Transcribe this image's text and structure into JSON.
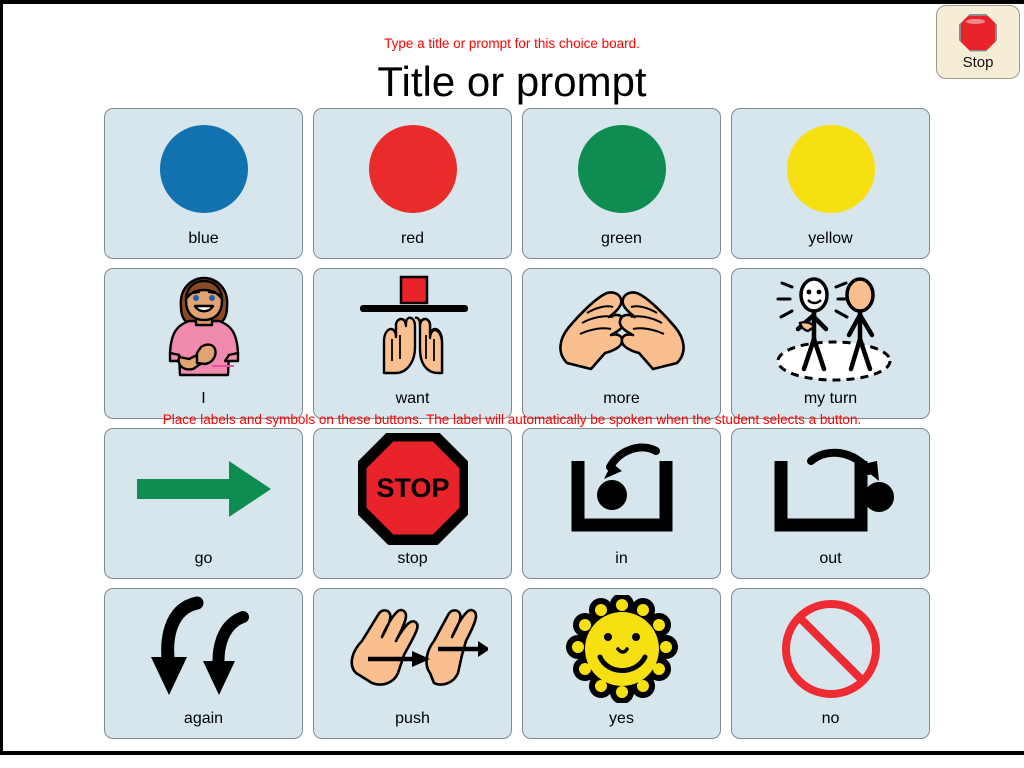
{
  "header": {
    "hint_top": "Type a title or prompt for this choice board.",
    "title": "Title or prompt"
  },
  "stop_button": {
    "label": "Stop",
    "icon": "stop-octagon-icon",
    "color": "#e8232a"
  },
  "overlay_hint": "Place labels and symbols on these buttons.   The label will automatically be spoken when the student selects a button.",
  "colors": {
    "cell_background": "#d6e6ec",
    "cell_border": "#7f8b8f",
    "hint_text": "#ff0000",
    "blue": "#1272b0",
    "red": "#ea2b2b",
    "green": "#0f8c52",
    "yellow": "#f7e011",
    "skin": "#f9bf8f",
    "shirt_pink": "#f08aae",
    "hair_brown": "#8a4b24"
  },
  "grid": {
    "columns": 4,
    "rows": 4,
    "cells": [
      {
        "label": "blue",
        "icon": "blue-circle-icon"
      },
      {
        "label": "red",
        "icon": "red-circle-icon"
      },
      {
        "label": "green",
        "icon": "green-circle-icon"
      },
      {
        "label": "yellow",
        "icon": "yellow-circle-icon"
      },
      {
        "label": "I",
        "icon": "person-pointing-self-icon"
      },
      {
        "label": "want",
        "icon": "hands-reaching-for-object-icon"
      },
      {
        "label": "more",
        "icon": "hands-fingertips-touching-icon"
      },
      {
        "label": "my turn",
        "icon": "two-stick-figures-icon"
      },
      {
        "label": "go",
        "icon": "green-right-arrow-icon"
      },
      {
        "label": "stop",
        "icon": "stop-sign-icon",
        "sign_text": "STOP"
      },
      {
        "label": "in",
        "icon": "ball-into-container-icon"
      },
      {
        "label": "out",
        "icon": "ball-out-of-container-icon"
      },
      {
        "label": "again",
        "icon": "two-curved-down-arrows-icon"
      },
      {
        "label": "push",
        "icon": "hands-pushing-icon"
      },
      {
        "label": "yes",
        "icon": "yellow-smiley-face-icon"
      },
      {
        "label": "no",
        "icon": "red-prohibition-icon"
      }
    ]
  }
}
